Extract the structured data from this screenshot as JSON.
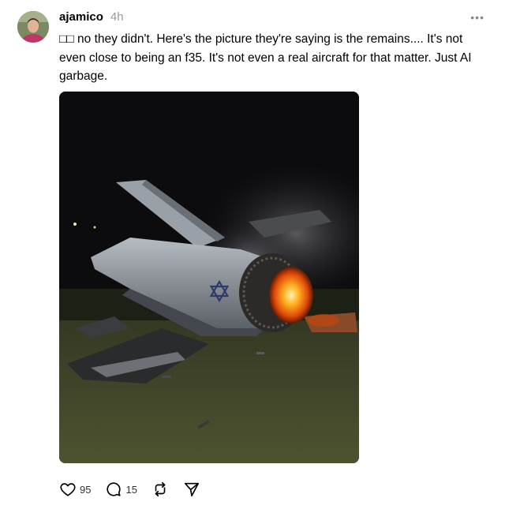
{
  "post": {
    "username": "ajamico",
    "time": "4h",
    "more_icon": "ellipsis-icon",
    "text": "□□ no they didn't. Here's the picture they're saying is the remains.... It's not even close to being an f35. It's not even a real aircraft for that matter. Just AI garbage.",
    "image_content": "Night photo of crashed fighter jet wreckage burning on grass, Star of David roundel on fuselage"
  },
  "actions": {
    "like": {
      "icon": "heart-icon",
      "count": "95"
    },
    "reply": {
      "icon": "comment-icon",
      "count": "15"
    },
    "repost": {
      "icon": "repost-icon"
    },
    "share": {
      "icon": "send-icon"
    }
  }
}
